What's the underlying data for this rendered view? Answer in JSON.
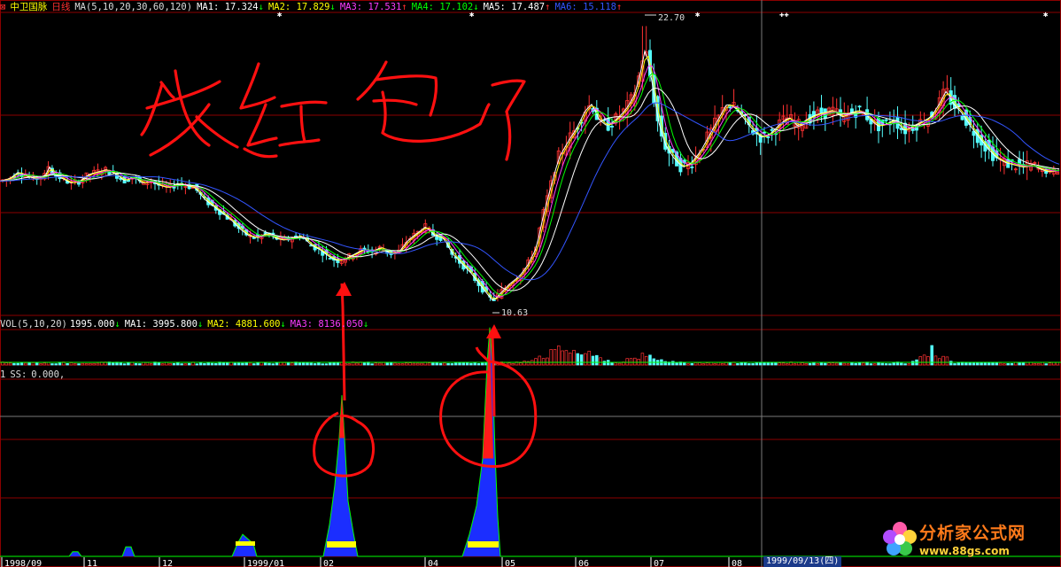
{
  "header": {
    "stock_name": "中卫国脉",
    "period": "日线",
    "ma_params": "MA(5,10,20,30,60,120)",
    "ma_values": [
      {
        "label": "MA1:",
        "value": "17.324",
        "arrow": "↓",
        "color": "#ffffff"
      },
      {
        "label": "MA2:",
        "value": "17.829",
        "arrow": "↓",
        "color": "#ffff00"
      },
      {
        "label": "MA3:",
        "value": "17.531",
        "arrow": "↑",
        "color": "#ff3cff"
      },
      {
        "label": "MA4:",
        "value": "17.102",
        "arrow": "↓",
        "color": "#00ff00"
      },
      {
        "label": "MA5:",
        "value": "17.487",
        "arrow": "↑",
        "color": "#ffffff"
      },
      {
        "label": "MA6:",
        "value": "15.118",
        "arrow": "↑",
        "color": "#3355ff"
      }
    ]
  },
  "vol_header": {
    "params": "VOL(5,10,20)",
    "vol_value": "1995.000",
    "vol_arrow": "↓",
    "ma_values": [
      {
        "label": "MA1:",
        "value": "3995.800",
        "arrow": "↓",
        "color": "#ffffff"
      },
      {
        "label": "MA2:",
        "value": "4881.600",
        "arrow": "↓",
        "color": "#ffff00"
      },
      {
        "label": "MA3:",
        "value": "8136.050",
        "arrow": "↓",
        "color": "#ff3cff"
      }
    ]
  },
  "ss_header": {
    "index": "1",
    "label": "SS:",
    "value": "0.000,"
  },
  "annotations": {
    "handwriting": "发红包了",
    "high_label": "22.70",
    "low_label": "10.63"
  },
  "date_axis": [
    "1998/09",
    "11",
    "12",
    "1999/01",
    "02",
    "04",
    "05",
    "06",
    "07",
    "08"
  ],
  "bottom_tab": "1999/09/13(四)",
  "logo": {
    "text": "分析家公式网",
    "url": "www.88gs.com"
  },
  "colors": {
    "up": "#ff3232",
    "down": "#54ffff",
    "grid": "#8b0000",
    "text": "#dddddd",
    "annotation": "#ff1010"
  },
  "chart_data": [
    {
      "type": "candlestick",
      "panel": "price",
      "title": "中卫国脉 日线",
      "ylim": [
        10.0,
        23.3
      ],
      "high": 22.7,
      "low": 10.63,
      "close_path": [
        [
          0,
          15.9
        ],
        [
          10,
          16.0
        ],
        [
          20,
          16.3
        ],
        [
          30,
          16.1
        ],
        [
          40,
          16.0
        ],
        [
          50,
          16.1
        ],
        [
          55,
          16.6
        ],
        [
          60,
          16.2
        ],
        [
          70,
          16.0
        ],
        [
          80,
          15.8
        ],
        [
          90,
          15.9
        ],
        [
          100,
          16.2
        ],
        [
          110,
          16.3
        ],
        [
          120,
          16.4
        ],
        [
          130,
          16.2
        ],
        [
          140,
          15.9
        ],
        [
          150,
          16.1
        ],
        [
          160,
          15.8
        ],
        [
          170,
          15.9
        ],
        [
          180,
          15.7
        ],
        [
          190,
          15.6
        ],
        [
          200,
          15.8
        ],
        [
          210,
          15.7
        ],
        [
          220,
          15.6
        ],
        [
          230,
          15.1
        ],
        [
          240,
          14.8
        ],
        [
          250,
          14.5
        ],
        [
          260,
          14.2
        ],
        [
          270,
          13.8
        ],
        [
          280,
          13.5
        ],
        [
          290,
          13.4
        ],
        [
          300,
          13.6
        ],
        [
          310,
          13.4
        ],
        [
          320,
          13.3
        ],
        [
          330,
          13.4
        ],
        [
          340,
          13.5
        ],
        [
          350,
          13.1
        ],
        [
          360,
          12.9
        ],
        [
          370,
          12.6
        ],
        [
          380,
          12.4
        ],
        [
          390,
          12.5
        ],
        [
          400,
          12.7
        ],
        [
          410,
          12.9
        ],
        [
          420,
          12.8
        ],
        [
          430,
          13.0
        ],
        [
          440,
          12.7
        ],
        [
          450,
          12.8
        ],
        [
          460,
          13.3
        ],
        [
          470,
          13.6
        ],
        [
          480,
          13.9
        ],
        [
          490,
          13.5
        ],
        [
          500,
          13.4
        ],
        [
          510,
          12.7
        ],
        [
          520,
          12.3
        ],
        [
          530,
          11.9
        ],
        [
          540,
          11.4
        ],
        [
          550,
          10.9
        ],
        [
          556,
          10.63
        ],
        [
          565,
          11.0
        ],
        [
          575,
          11.4
        ],
        [
          585,
          11.7
        ],
        [
          595,
          12.2
        ],
        [
          605,
          13.0
        ],
        [
          612,
          14.3
        ],
        [
          620,
          15.5
        ],
        [
          630,
          16.9
        ],
        [
          640,
          17.6
        ],
        [
          650,
          18.2
        ],
        [
          660,
          19.0
        ],
        [
          668,
          19.3
        ],
        [
          675,
          18.6
        ],
        [
          685,
          18.3
        ],
        [
          695,
          18.6
        ],
        [
          705,
          19.0
        ],
        [
          715,
          19.6
        ],
        [
          722,
          20.6
        ],
        [
          728,
          21.8
        ],
        [
          735,
          20.3
        ],
        [
          742,
          18.6
        ],
        [
          750,
          17.5
        ],
        [
          760,
          16.9
        ],
        [
          770,
          16.5
        ],
        [
          780,
          16.7
        ],
        [
          790,
          17.2
        ],
        [
          800,
          17.9
        ],
        [
          810,
          18.6
        ],
        [
          820,
          19.3
        ],
        [
          830,
          19.1
        ],
        [
          840,
          18.6
        ],
        [
          850,
          18.1
        ],
        [
          860,
          17.8
        ],
        [
          870,
          18.0
        ],
        [
          880,
          18.4
        ],
        [
          890,
          18.7
        ],
        [
          900,
          18.3
        ],
        [
          910,
          18.6
        ],
        [
          920,
          18.8
        ],
        [
          930,
          18.9
        ],
        [
          940,
          19.0
        ],
        [
          950,
          18.7
        ],
        [
          960,
          18.9
        ],
        [
          970,
          19.0
        ],
        [
          980,
          18.7
        ],
        [
          990,
          18.3
        ],
        [
          1000,
          18.4
        ],
        [
          1010,
          18.6
        ],
        [
          1020,
          18.1
        ],
        [
          1030,
          18.3
        ],
        [
          1040,
          18.5
        ],
        [
          1050,
          18.7
        ],
        [
          1060,
          19.3
        ],
        [
          1068,
          19.9
        ],
        [
          1075,
          19.3
        ],
        [
          1085,
          18.9
        ],
        [
          1095,
          18.3
        ],
        [
          1105,
          17.8
        ],
        [
          1115,
          17.3
        ],
        [
          1125,
          16.9
        ],
        [
          1135,
          16.7
        ],
        [
          1145,
          16.6
        ],
        [
          1155,
          16.5
        ],
        [
          1165,
          16.6
        ],
        [
          1175,
          16.4
        ],
        [
          1185,
          16.3
        ],
        [
          1198,
          16.4
        ]
      ],
      "ma_series": [
        {
          "name": "MA1",
          "color": "#ffffff",
          "lag": 3
        },
        {
          "name": "MA2",
          "color": "#ffff00",
          "lag": 7
        },
        {
          "name": "MA3",
          "color": "#ff3cff",
          "lag": 14
        },
        {
          "name": "MA4",
          "color": "#00ff00",
          "lag": 22
        },
        {
          "name": "MA5",
          "color": "#ffffff",
          "lag": 40
        },
        {
          "name": "MA6",
          "color": "#3355ff",
          "lag": 85
        }
      ]
    },
    {
      "type": "bar",
      "panel": "volume",
      "title": "VOL(5,10,20)",
      "ylim": [
        0,
        30000
      ],
      "baseline": 1995,
      "surges": [
        {
          "from": 590,
          "to": 690,
          "peak": 19000
        },
        {
          "from": 700,
          "to": 760,
          "peak": 13000
        },
        {
          "from": 1030,
          "to": 1075,
          "peak": 17000
        }
      ]
    },
    {
      "type": "area",
      "panel": "indicator",
      "title": "SS",
      "ylim": [
        0,
        100
      ],
      "series": [
        {
          "name": "SS",
          "points": [
            [
              0,
              0
            ],
            [
              78,
              0
            ],
            [
              82,
              3
            ],
            [
              88,
              3
            ],
            [
              92,
              0
            ],
            [
              138,
              0
            ],
            [
              142,
              6
            ],
            [
              148,
              6
            ],
            [
              152,
              0
            ],
            [
              262,
              0
            ],
            [
              268,
              8
            ],
            [
              274,
              14
            ],
            [
              280,
              11
            ],
            [
              286,
              8
            ],
            [
              290,
              0
            ],
            [
              365,
              0
            ],
            [
              372,
              20
            ],
            [
              378,
              45
            ],
            [
              383,
              75
            ],
            [
              386,
              102
            ],
            [
              389,
              75
            ],
            [
              393,
              35
            ],
            [
              399,
              15
            ],
            [
              404,
              0
            ],
            [
              522,
              0
            ],
            [
              530,
              14
            ],
            [
              538,
              32
            ],
            [
              545,
              62
            ],
            [
              550,
              122
            ],
            [
              553,
              145
            ],
            [
              556,
              122
            ],
            [
              559,
              65
            ],
            [
              562,
              25
            ],
            [
              565,
              0
            ],
            [
              1198,
              0
            ]
          ]
        }
      ]
    }
  ]
}
